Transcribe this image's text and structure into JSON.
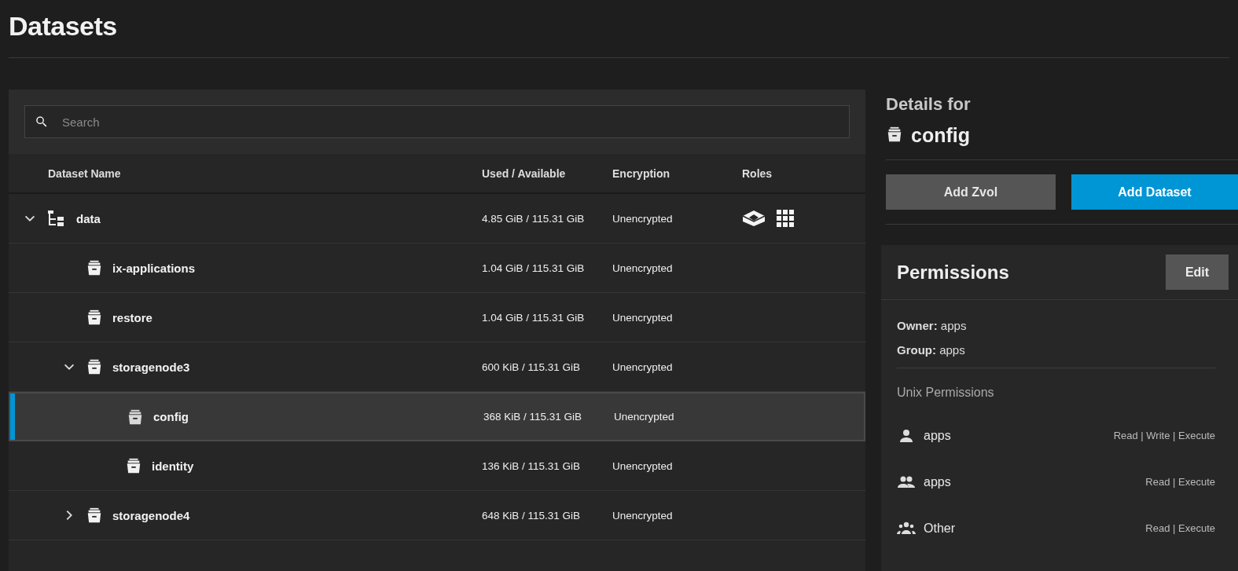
{
  "page": {
    "title": "Datasets"
  },
  "search": {
    "placeholder": "Search"
  },
  "table": {
    "columns": [
      "Dataset Name",
      "Used / Available",
      "Encryption",
      "Roles"
    ],
    "rows": [
      {
        "kind": "pool",
        "name": "data",
        "usage": "4.85 GiB / 115.31 GiB",
        "encryption": "Unencrypted",
        "expanded": true,
        "selected": false,
        "children": [
          {
            "kind": "leaf",
            "name": "ix-applications",
            "usage": "1.04 GiB / 115.31 GiB",
            "encryption": "Unencrypted",
            "selected": false
          },
          {
            "kind": "leaf",
            "name": "restore",
            "usage": "1.04 GiB / 115.31 GiB",
            "encryption": "Unencrypted",
            "selected": false
          },
          {
            "kind": "parent",
            "name": "storagenode3",
            "usage": "600 KiB / 115.31 GiB",
            "encryption": "Unencrypted",
            "expanded": true,
            "selected": false,
            "children": [
              {
                "kind": "leaf",
                "name": "config",
                "usage": "368 KiB / 115.31 GiB",
                "encryption": "Unencrypted",
                "selected": true
              },
              {
                "kind": "leaf",
                "name": "identity",
                "usage": "136 KiB / 115.31 GiB",
                "encryption": "Unencrypted",
                "selected": false
              }
            ]
          },
          {
            "kind": "parent",
            "name": "storagenode4",
            "usage": "648 KiB / 115.31 GiB",
            "encryption": "Unencrypted",
            "expanded": false,
            "selected": false
          }
        ]
      }
    ]
  },
  "details": {
    "heading": "Details for",
    "name": "config",
    "buttons": [
      {
        "label": "Add Zvol",
        "kind": "secondary"
      },
      {
        "label": "Add Dataset",
        "kind": "primary"
      }
    ]
  },
  "permissions": {
    "title": "Permissions",
    "edit": "Edit",
    "owner_label": "Owner:",
    "owner": "apps",
    "group_label": "Group:",
    "group": "apps",
    "section": "Unix Permissions",
    "entries": [
      {
        "kind": "user",
        "name": "apps",
        "access": "Read | Write | Execute"
      },
      {
        "kind": "group",
        "name": "apps",
        "access": "Read | Execute"
      },
      {
        "kind": "other",
        "name": "Other",
        "access": "Read | Execute"
      }
    ]
  }
}
